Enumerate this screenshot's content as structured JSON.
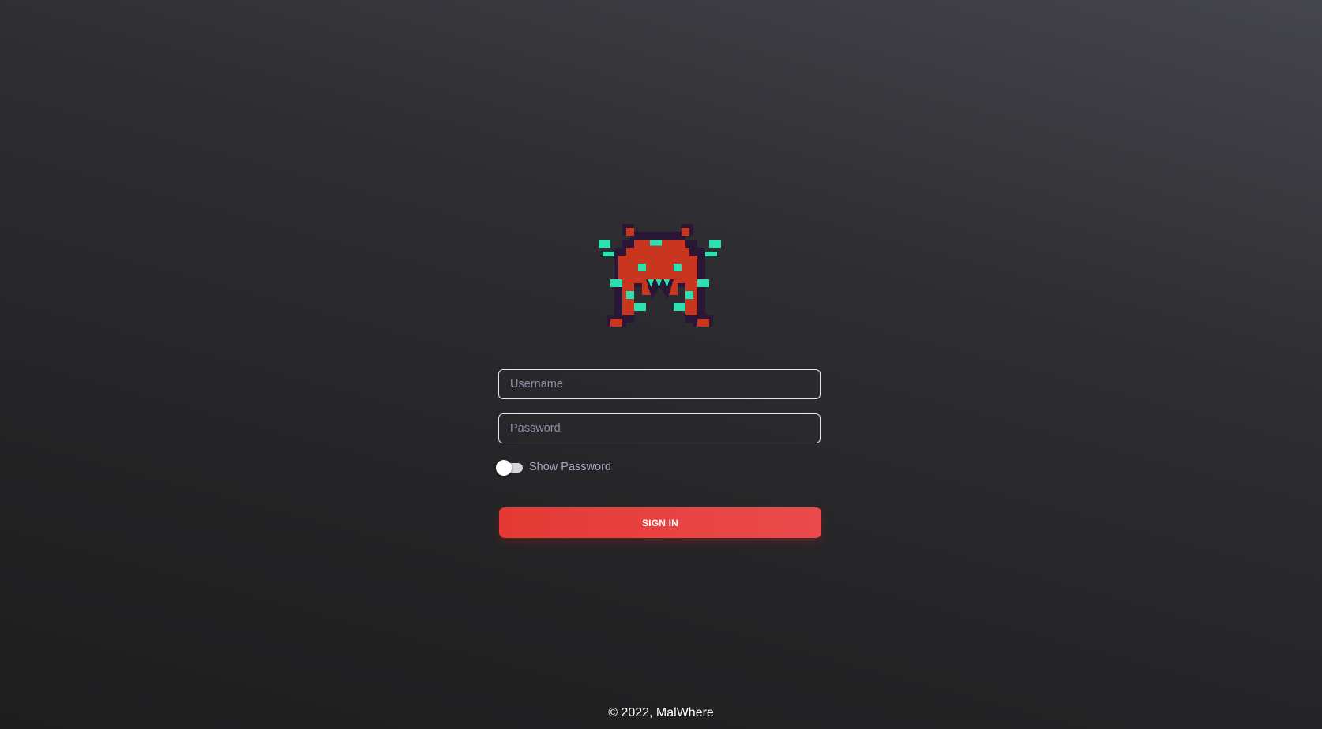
{
  "logo": {
    "icon": "pixel-invader-logo",
    "colors": {
      "body": "#c8361f",
      "outline": "#2a1636",
      "accent": "#2de0b0"
    }
  },
  "form": {
    "username_placeholder": "Username",
    "password_placeholder": "Password",
    "username_value": "",
    "password_value": "",
    "show_password_label": "Show Password",
    "show_password_on": false,
    "signin_label": "SIGN IN"
  },
  "footer": {
    "text": "© 2022, MalWhere"
  },
  "colors": {
    "accent": "#e8423f",
    "input_border": "#e4e4ea",
    "placeholder": "#8d8fa6"
  }
}
